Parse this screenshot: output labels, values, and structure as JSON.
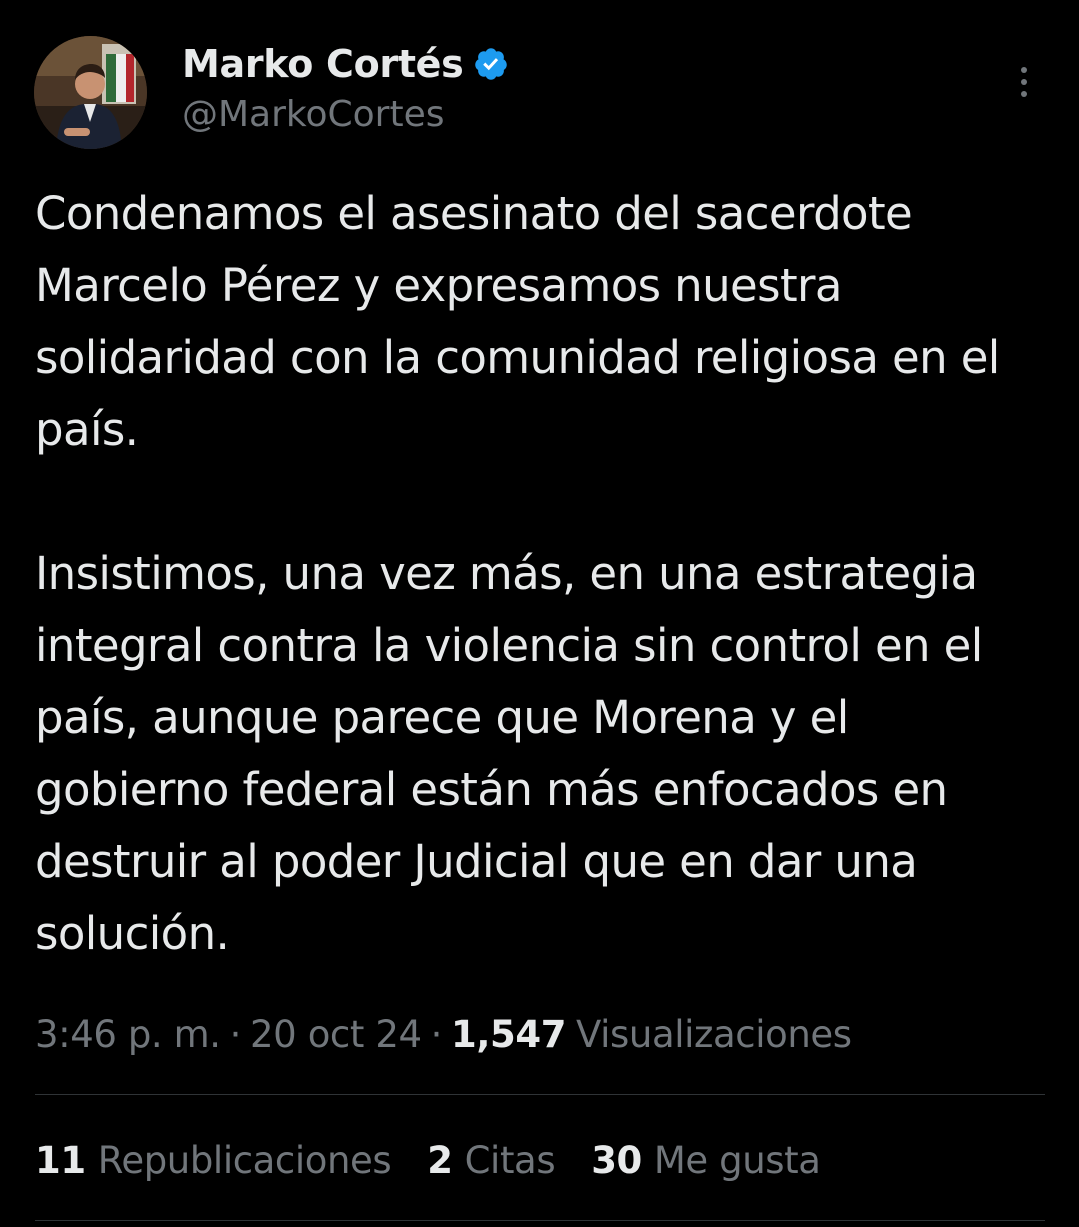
{
  "author": {
    "display_name": "Marko Cortés",
    "handle": "@MarkoCortes",
    "verified_icon": "verified-badge-icon",
    "accent_color": "#1d9bf0"
  },
  "tweet": {
    "paragraphs": [
      "Condenamos el asesinato del sacerdote Marcelo Pérez y expresamos nuestra solidaridad con la comunidad religiosa en el país.",
      "Insistimos, una vez más, en una estrategia integral contra la violencia sin control en el país, aunque parece que Morena y el gobierno federal están más enfocados en destruir al poder Judicial que en dar una solución."
    ]
  },
  "meta": {
    "time": "3:46 p. m.",
    "separator": "·",
    "date": "20 oct 24",
    "views_count": "1,547",
    "views_label": "Visualizaciones"
  },
  "stats": [
    {
      "count": "11",
      "label": "Republicaciones"
    },
    {
      "count": "2",
      "label": "Citas"
    },
    {
      "count": "30",
      "label": "Me gusta"
    }
  ],
  "colors": {
    "background": "#000000",
    "text_primary": "#e7e9ea",
    "text_secondary": "#71767b",
    "divider": "#2f3336"
  }
}
